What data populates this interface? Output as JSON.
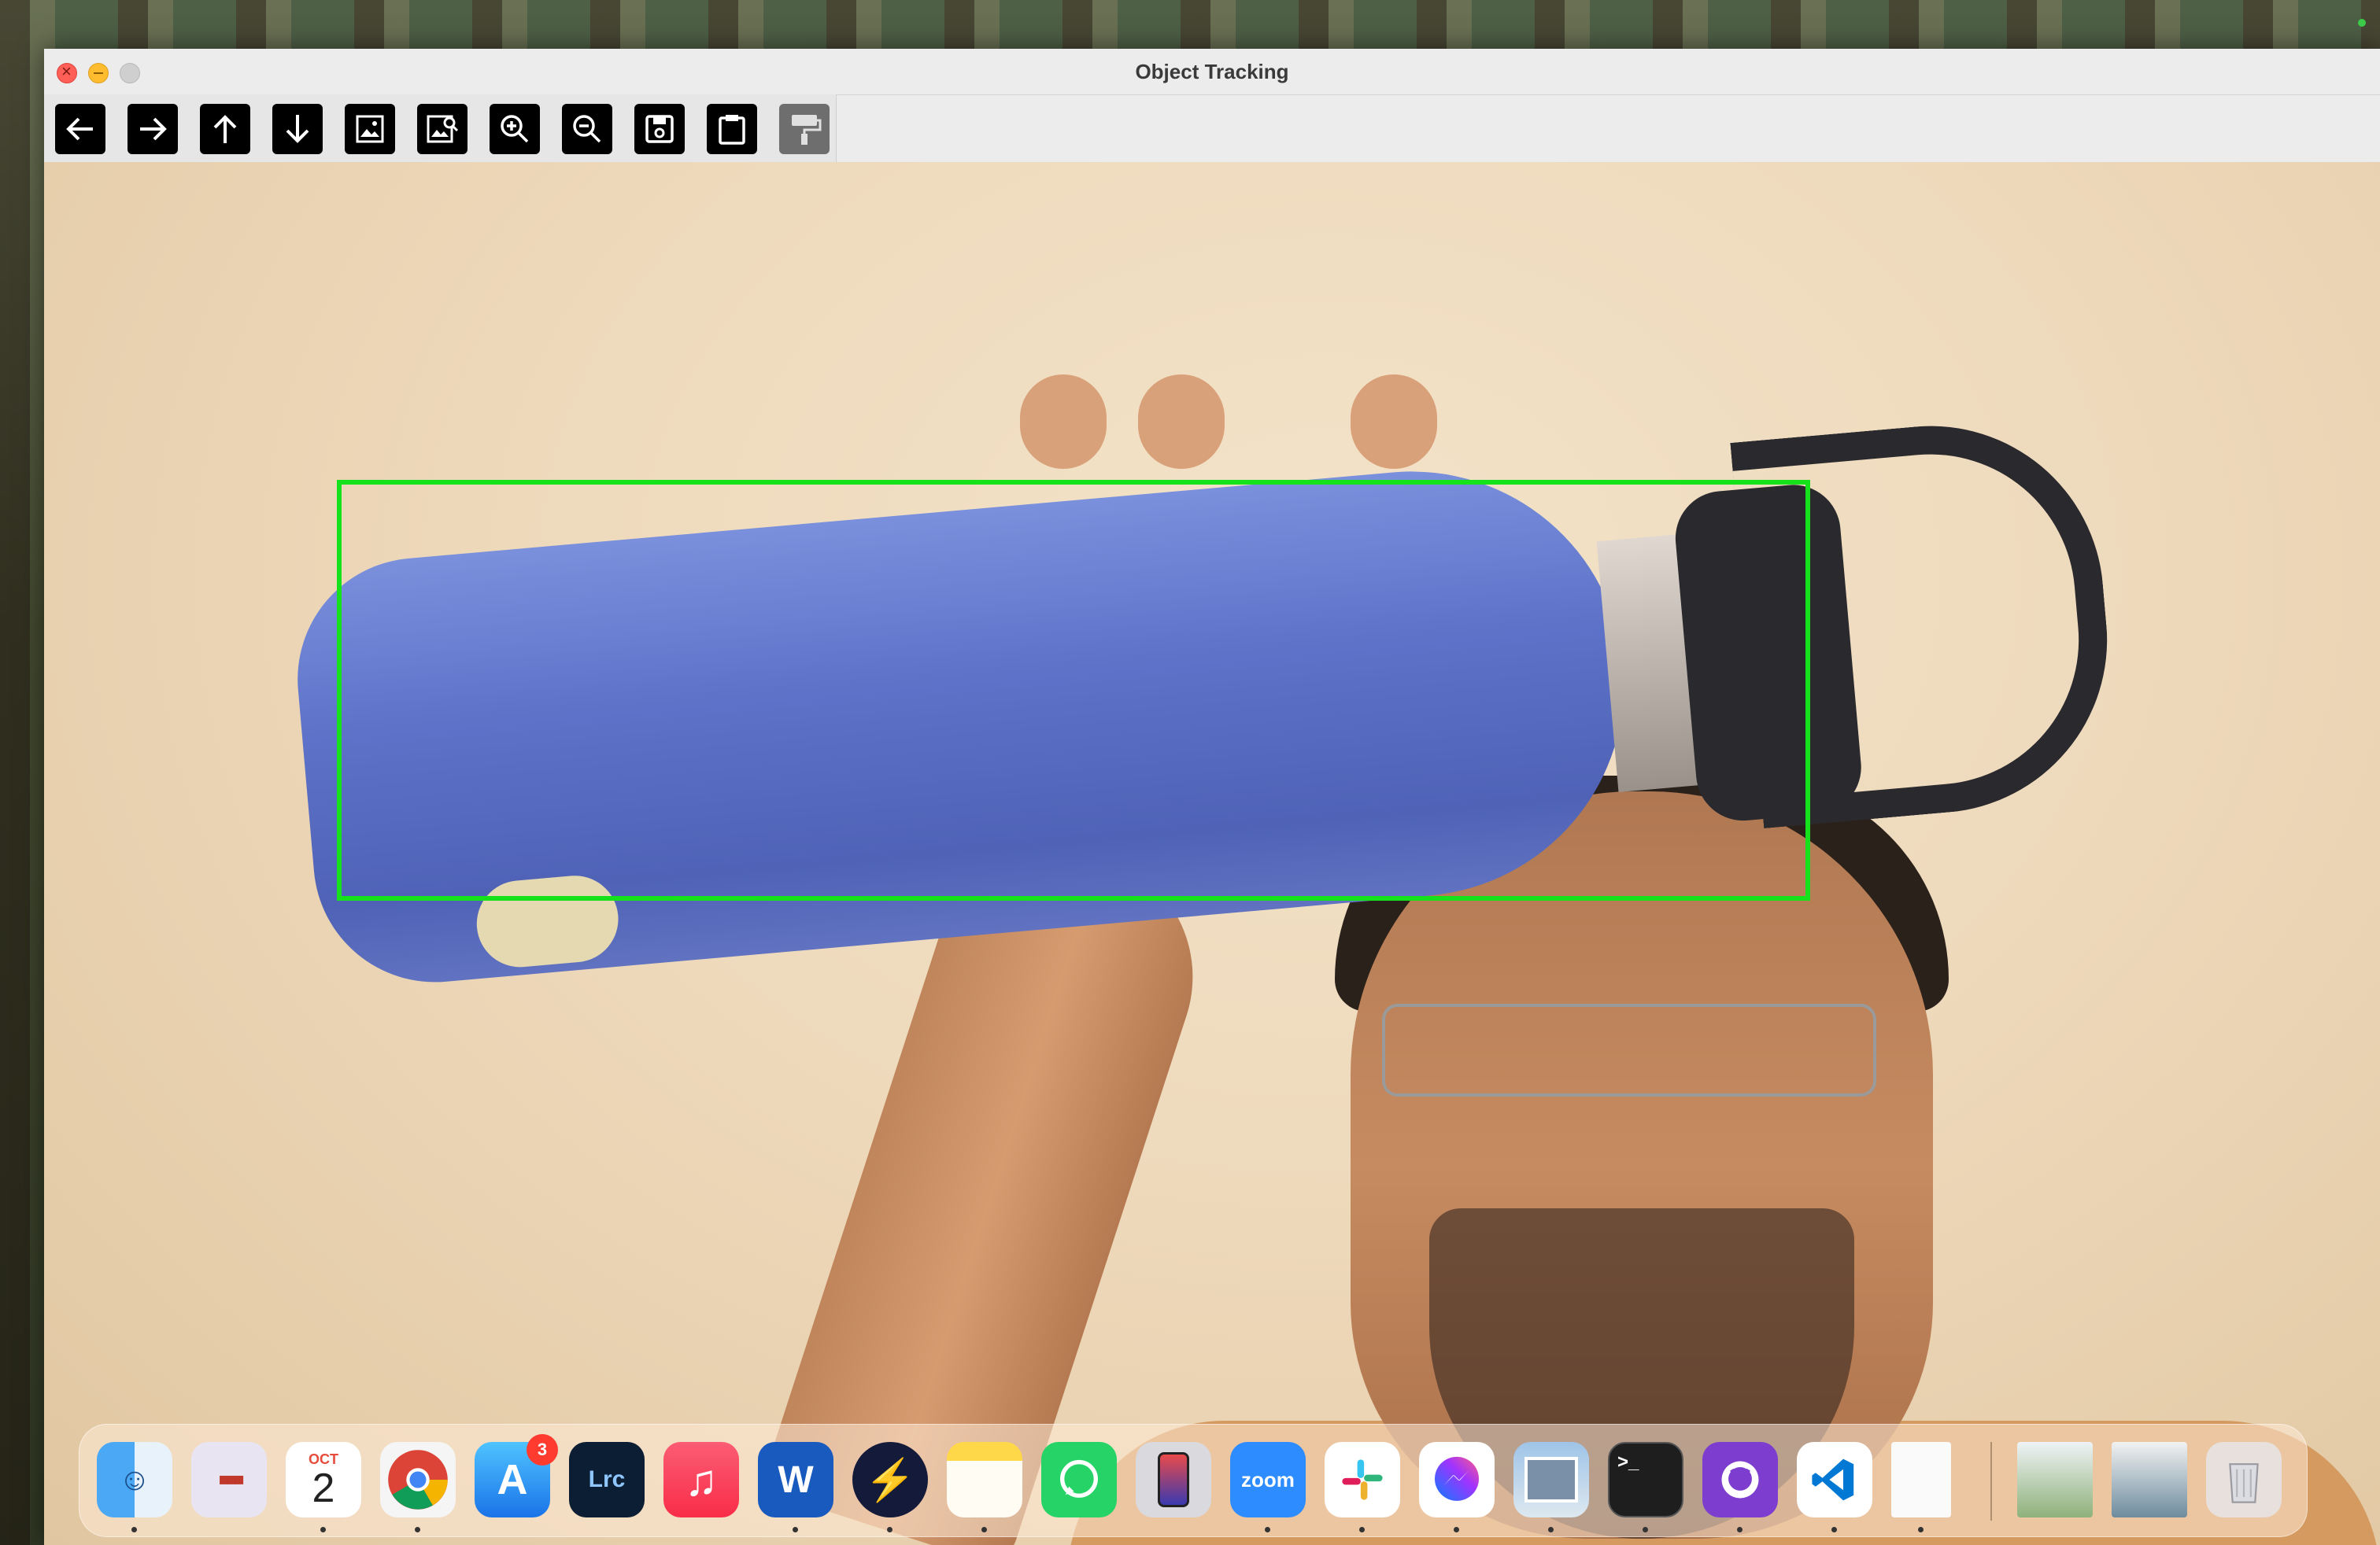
{
  "window": {
    "title": "Object Tracking"
  },
  "toolbar": {
    "buttons": [
      {
        "name": "back-button",
        "icon": "arrow-left-icon"
      },
      {
        "name": "forward-button",
        "icon": "arrow-right-icon"
      },
      {
        "name": "up-button",
        "icon": "arrow-up-icon"
      },
      {
        "name": "down-button",
        "icon": "arrow-down-icon"
      },
      {
        "name": "image-button",
        "icon": "image-icon"
      },
      {
        "name": "image-properties-button",
        "icon": "image-search-icon"
      },
      {
        "name": "zoom-in-button",
        "icon": "zoom-in-icon"
      },
      {
        "name": "zoom-out-button",
        "icon": "zoom-out-icon"
      },
      {
        "name": "save-button",
        "icon": "save-icon"
      },
      {
        "name": "copy-button",
        "icon": "clipboard-icon"
      },
      {
        "name": "properties-button",
        "icon": "paint-roller-icon"
      }
    ]
  },
  "tracking": {
    "box_color": "#16e21b"
  },
  "dock": {
    "items": [
      {
        "name": "finder",
        "icon": "finder-icon",
        "label": ""
      },
      {
        "name": "launchpad",
        "icon": "launchpad-icon",
        "label": ""
      },
      {
        "name": "calendar",
        "icon": "calendar-icon",
        "month": "OCT",
        "day": "2"
      },
      {
        "name": "chrome",
        "icon": "chrome-icon",
        "label": ""
      },
      {
        "name": "app-store",
        "icon": "app-store-icon",
        "badge": "3"
      },
      {
        "name": "lightroom-classic",
        "icon": "lightroom-icon",
        "label": "Lrc"
      },
      {
        "name": "music",
        "icon": "music-icon",
        "label": "♫"
      },
      {
        "name": "word",
        "icon": "word-icon",
        "label": "W"
      },
      {
        "name": "reeder",
        "icon": "bolt-icon",
        "label": "⚡"
      },
      {
        "name": "notes",
        "icon": "notes-icon",
        "label": ""
      },
      {
        "name": "whatsapp",
        "icon": "whatsapp-icon",
        "label": ""
      },
      {
        "name": "iphone-mirroring",
        "icon": "iphone-icon",
        "label": ""
      },
      {
        "name": "zoom",
        "icon": "zoom-app-icon",
        "label": "zoom"
      },
      {
        "name": "slack",
        "icon": "slack-icon",
        "label": ""
      },
      {
        "name": "messenger",
        "icon": "messenger-icon",
        "label": ""
      },
      {
        "name": "preview",
        "icon": "preview-icon",
        "label": ""
      },
      {
        "name": "terminal",
        "icon": "terminal-icon",
        "label": ">_"
      },
      {
        "name": "github-desktop",
        "icon": "github-icon",
        "label": ""
      },
      {
        "name": "vscode",
        "icon": "vscode-icon",
        "label": ""
      },
      {
        "name": "document",
        "icon": "document-icon",
        "label": ""
      },
      {
        "name": "recent-file-1",
        "icon": "thumbnail-icon",
        "label": ""
      },
      {
        "name": "recent-file-2",
        "icon": "thumbnail-icon",
        "label": ""
      },
      {
        "name": "trash",
        "icon": "trash-icon",
        "label": ""
      }
    ]
  }
}
